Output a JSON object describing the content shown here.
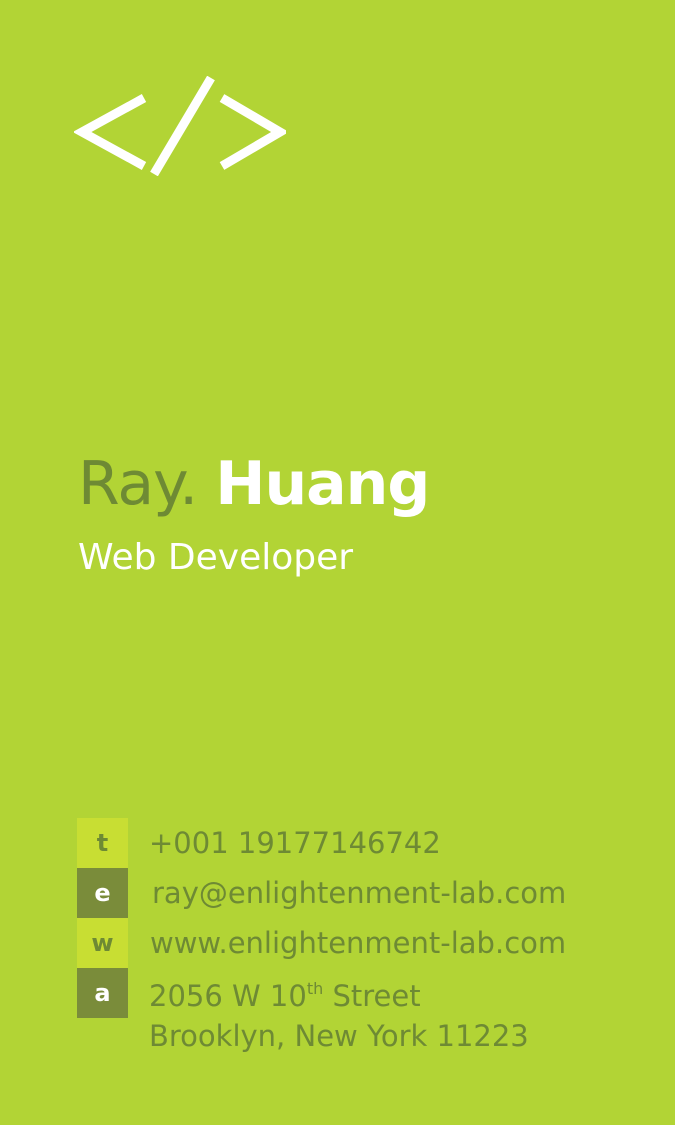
{
  "colors": {
    "background": "#b2d435",
    "accent_dark": "#7a8c3a",
    "accent_light": "#c8de33",
    "text_olive": "#6e8a34",
    "text_white": "#ffffff"
  },
  "logo": {
    "icon": "code-brackets-icon"
  },
  "name": {
    "first": "Ray.",
    "last": "Huang"
  },
  "job_title": "Web Developer",
  "contacts": {
    "phone": {
      "badge": "t",
      "value": "+001 19177146742"
    },
    "email": {
      "badge": "e",
      "value": "ray@enlightenment-lab.com"
    },
    "website": {
      "badge": "w",
      "value": "www.enlightenment-lab.com"
    },
    "address": {
      "badge": "a",
      "line1_prefix": "2056 W 10",
      "line1_sup": "th",
      "line1_suffix": " Street",
      "line2": "Brooklyn, New York 11223"
    }
  }
}
